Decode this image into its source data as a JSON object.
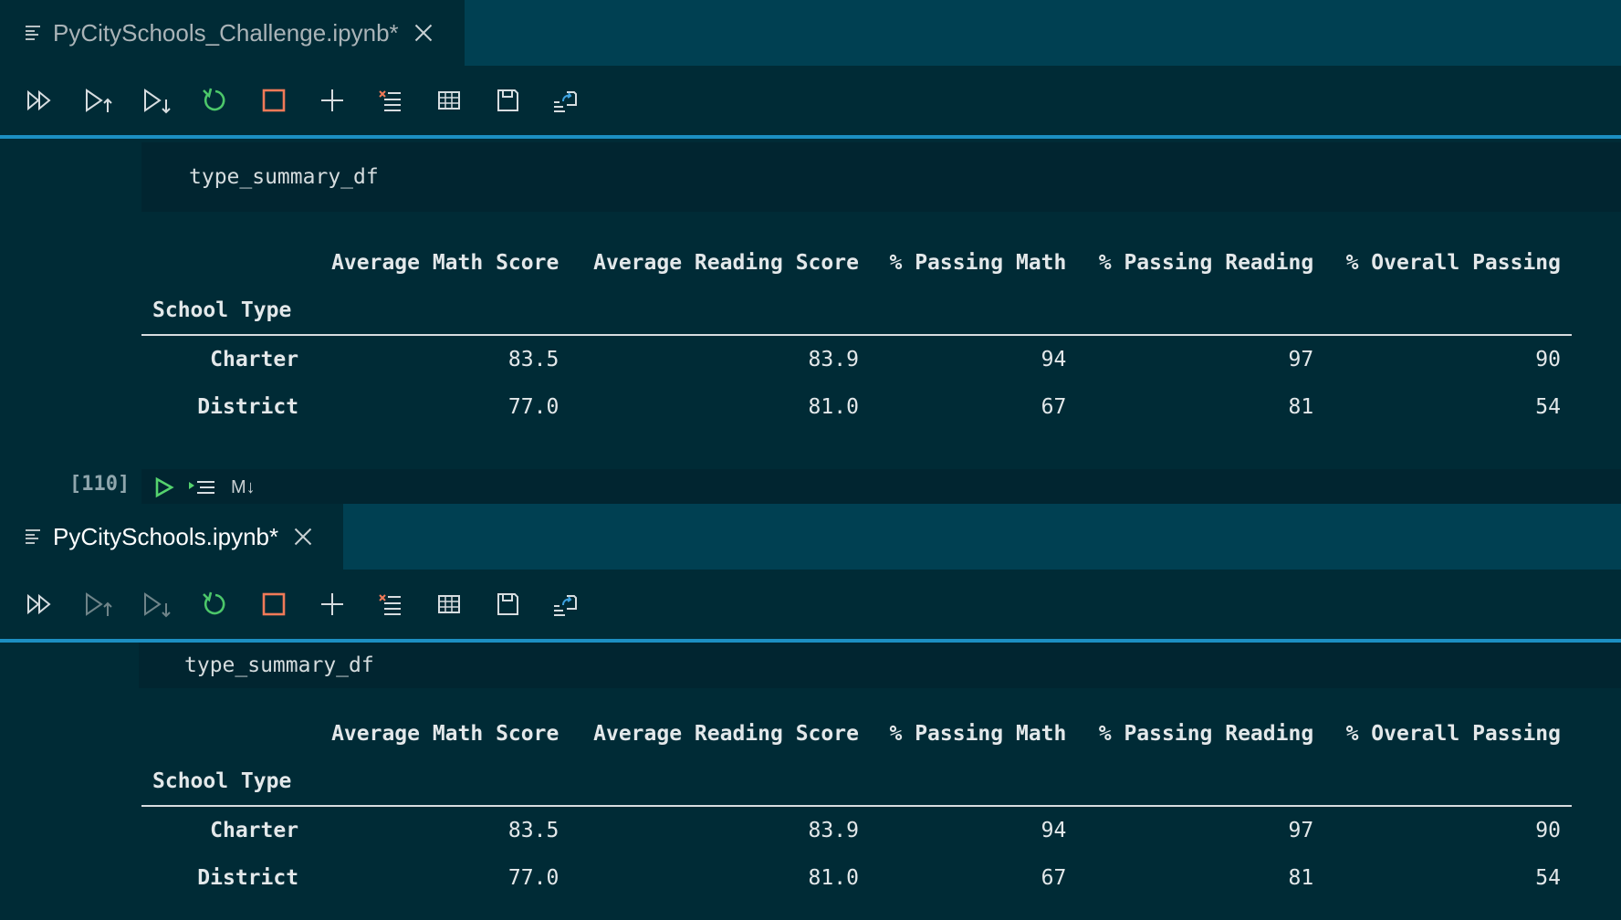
{
  "colors": {
    "background": "#002b36",
    "tabbar": "#004052",
    "accent_border": "#1c8fc2",
    "restart_icon": "#4cc76a",
    "stop_icon": "#f07a58",
    "run_icon": "#55d26e"
  },
  "top_pane": {
    "tab": {
      "title": "PyCitySchools_Challenge.ipynb*",
      "icon": "file-lines-icon"
    },
    "code": "type_summary_df",
    "table": {
      "columns": [
        "Average Math Score",
        "Average Reading Score",
        "% Passing Math",
        "% Passing Reading",
        "% Overall Passing"
      ],
      "index_name": "School Type",
      "rows": [
        {
          "label": "Charter",
          "values": [
            "83.5",
            "83.9",
            "94",
            "97",
            "90"
          ]
        },
        {
          "label": "District",
          "values": [
            "77.0",
            "81.0",
            "67",
            "81",
            "54"
          ]
        }
      ]
    },
    "exec_count": "[110]",
    "markdown_label": "M↓"
  },
  "bottom_pane": {
    "tab": {
      "title": "PyCitySchools.ipynb*",
      "icon": "file-lines-icon"
    },
    "code": "type_summary_df",
    "table": {
      "columns": [
        "Average Math Score",
        "Average Reading Score",
        "% Passing Math",
        "% Passing Reading",
        "% Overall Passing"
      ],
      "index_name": "School Type",
      "rows": [
        {
          "label": "Charter",
          "values": [
            "83.5",
            "83.9",
            "94",
            "97",
            "90"
          ]
        },
        {
          "label": "District",
          "values": [
            "77.0",
            "81.0",
            "67",
            "81",
            "54"
          ]
        }
      ]
    }
  }
}
